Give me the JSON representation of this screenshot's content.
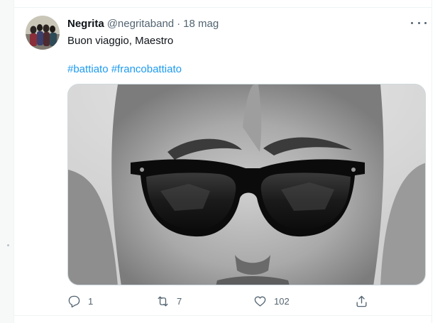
{
  "tweet": {
    "author_name": "Negrita",
    "author_handle": "@negritaband",
    "separator": "·",
    "time": "18 mag",
    "text": "Buon viaggio, Maestro",
    "hashtags": [
      "#battiato",
      "#francobattiato"
    ]
  },
  "actions": {
    "reply_count": "1",
    "retweet_count": "7",
    "like_count": "102"
  },
  "icons": {
    "more": "more-horizontal-icon",
    "reply": "reply-icon",
    "retweet": "retweet-icon",
    "like": "heart-icon",
    "share": "share-icon"
  },
  "colors": {
    "link": "#1d9bf0",
    "secondary_text": "#536471",
    "primary_text": "#0f1419"
  }
}
